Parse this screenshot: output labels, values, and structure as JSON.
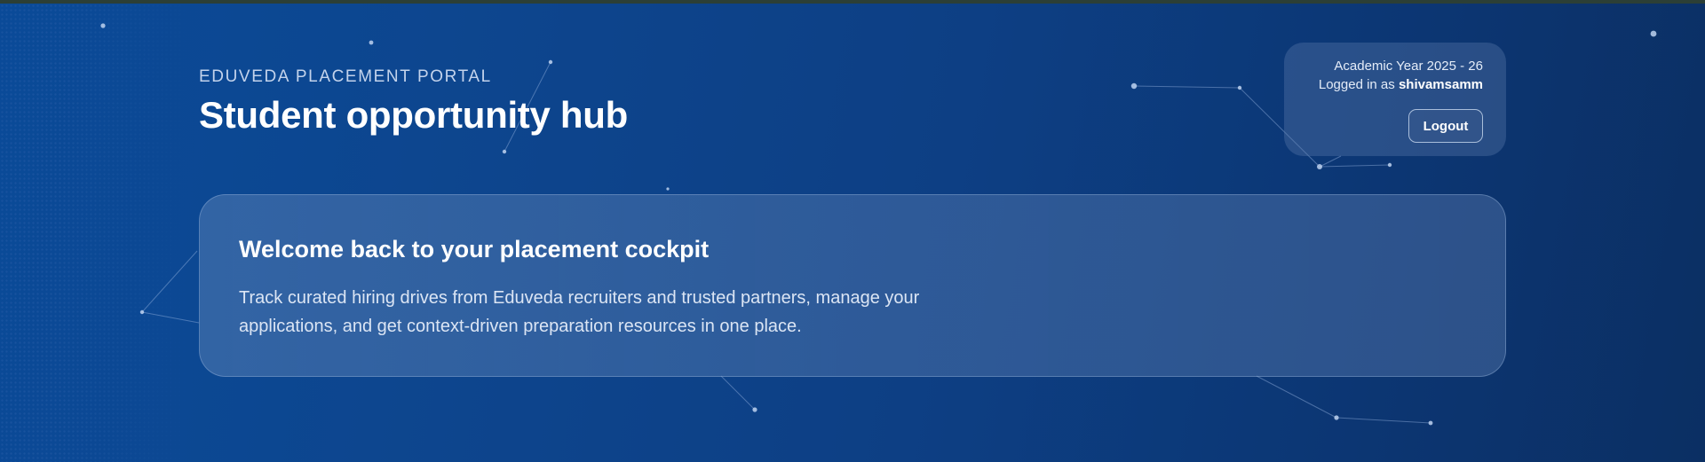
{
  "header": {
    "eyebrow": "EDUVEDA PLACEMENT PORTAL",
    "title": "Student opportunity hub"
  },
  "account": {
    "academic_year": "Academic Year 2025 - 26",
    "logged_in_prefix": "Logged in as ",
    "username": "shivamsamm",
    "logout_label": "Logout"
  },
  "welcome": {
    "title": "Welcome back to your placement cockpit",
    "text": "Track curated hiring drives from Eduveda recruiters and trusted partners, manage your applications, and get context-driven preparation resources in one place."
  },
  "colors": {
    "background_start": "#0a4a98",
    "background_end": "#0b2f63",
    "text_primary": "#ffffff",
    "text_muted": "#c3d3ec"
  }
}
